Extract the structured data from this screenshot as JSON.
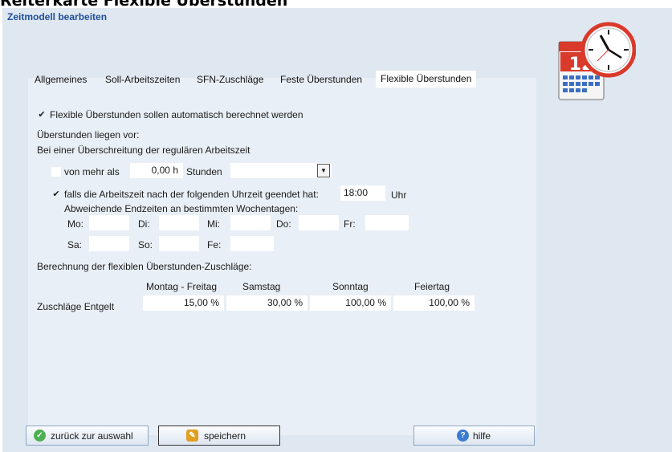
{
  "doc_title": "Reiterkarte Flexible Überstunden",
  "window_title": "Zeitmodell bearbeiten",
  "tabs": [
    "Allgemeines",
    "Soll-Arbeitszeiten",
    "SFN-Zuschläge",
    "Feste Überstunden",
    "Flexible Überstunden"
  ],
  "active_tab": "Flexible Überstunden",
  "auto_calc": {
    "checked": true,
    "label": "Flexible Überstunden sollen automatisch berechnet werden"
  },
  "overtime_heading": "Überstunden liegen vor:",
  "exceed_heading": "Bei einer Überschreitung der regulären Arbeitszeit",
  "more_than": {
    "checked": false,
    "label": "von mehr als",
    "value": "0,00 h",
    "unit": "Stunden",
    "select_value": ""
  },
  "end_time": {
    "checked": true,
    "label": "falls die Arbeitszeit nach der folgenden Uhrzeit geendet hat:",
    "value": "18:00",
    "unit": "Uhr"
  },
  "weekday_heading": "Abweichende Endzeiten an bestimmten Wochentagen:",
  "weekdays": {
    "mo": "Mo:",
    "di": "Di:",
    "mi": "Mi:",
    "do": "Do:",
    "fr": "Fr:",
    "sa": "Sa:",
    "so": "So:",
    "fe": "Fe:"
  },
  "surcharge_heading": "Berechnung der flexiblen Überstunden-Zuschläge:",
  "surcharge_columns": [
    "Montag - Freitag",
    "Samstag",
    "Sonntag",
    "Feiertag"
  ],
  "surcharge_row_label": "Zuschläge Entgelt",
  "surcharge_values": [
    "15,00 %",
    "30,00 %",
    "100,00 %",
    "100,00 %"
  ],
  "buttons": {
    "back": "zurück zur auswahl",
    "save": "speichern",
    "help": "hilfe"
  },
  "colors": {
    "window_bg": "#dfe7f0",
    "panel_bg": "#e9eff6",
    "title_blue": "#1f4e9c",
    "ok_green": "#4caf50",
    "help_blue": "#3b7bd0"
  }
}
